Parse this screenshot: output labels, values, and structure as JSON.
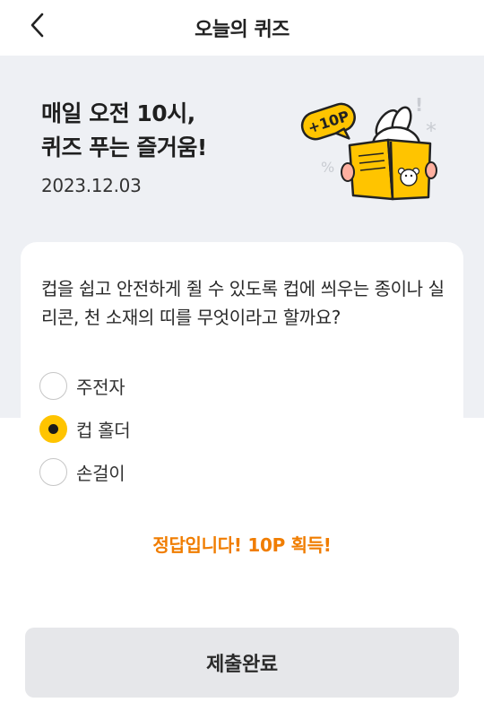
{
  "header": {
    "title": "오늘의 퀴즈"
  },
  "hero": {
    "headline_line1": "매일 오전 10시,",
    "headline_line2": "퀴즈 푸는 즐거움!",
    "date": "2023.12.03",
    "badge_text": "+10P"
  },
  "quiz": {
    "question": "컵을 쉽고 안전하게 쥘 수 있도록 컵에 씌우는 종이나 실리콘, 천 소재의 띠를 무엇이라고 할까요?",
    "options": [
      {
        "label": "주전자",
        "selected": false
      },
      {
        "label": "컵 홀더",
        "selected": true
      },
      {
        "label": "손걸이",
        "selected": false
      }
    ],
    "result_text": "정답입니다! 10P 획득!",
    "submit_label": "제출완료"
  },
  "colors": {
    "accent": "#ffc400",
    "result": "#f07d00",
    "hero_bg": "#eef0f4",
    "button_bg": "#e6e7ea"
  }
}
